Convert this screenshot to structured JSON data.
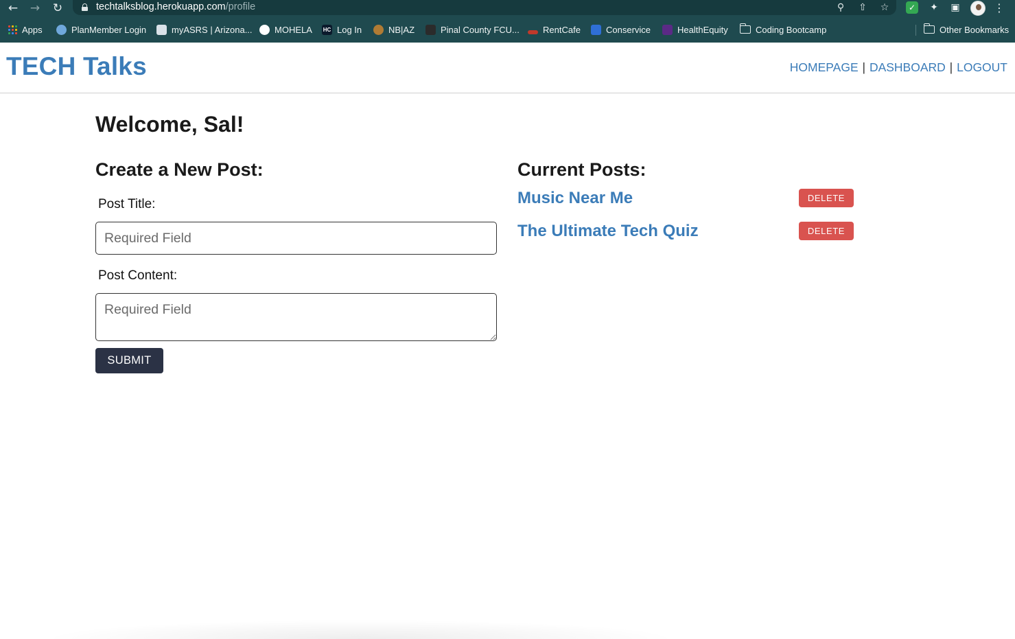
{
  "browser": {
    "url_host": "techtalksblog.herokuapp.com",
    "url_path": "/profile",
    "nav_icons": [
      "arrow-left-icon",
      "arrow-right-icon",
      "reload-icon"
    ],
    "omnibox_icons": [
      "key-icon",
      "share-icon",
      "star-icon"
    ],
    "bookmarks": [
      {
        "label": "Apps",
        "icon": "apps-grid-icon",
        "color": "#e8453c"
      },
      {
        "label": "PlanMember Login",
        "icon": "planmember-favicon",
        "color": "#6fa8dc"
      },
      {
        "label": "myASRS | Arizona...",
        "icon": "myasrs-favicon",
        "color": "#d9e1e8"
      },
      {
        "label": "MOHELA",
        "icon": "mohela-favicon",
        "color": "#ffffff"
      },
      {
        "label": "Log In",
        "icon": "hc-favicon",
        "color": "#0b1a2c"
      },
      {
        "label": "NB|AZ",
        "icon": "nbaz-favicon",
        "color": "#b07b34"
      },
      {
        "label": "Pinal County FCU...",
        "icon": "pinal-favicon",
        "color": "#2b2b2b"
      },
      {
        "label": "RentCafe",
        "icon": "rentcafe-favicon",
        "color": "#c0392b"
      },
      {
        "label": "Conservice",
        "icon": "conservice-favicon",
        "color": "#2f6fd6"
      },
      {
        "label": "HealthEquity",
        "icon": "healthequity-favicon",
        "color": "#5b2a86"
      },
      {
        "label": "Coding Bootcamp",
        "icon": "folder-icon",
        "color": "#e4ecec"
      }
    ],
    "other_bookmarks": "Other Bookmarks"
  },
  "site": {
    "title": "TECH Talks",
    "nav": {
      "homepage": "HOMEPAGE",
      "dashboard": "DASHBOARD",
      "logout": "LOGOUT",
      "separator": "|"
    }
  },
  "main": {
    "welcome": "Welcome, Sal!",
    "create": {
      "heading": "Create a New Post:",
      "title_label": "Post Title:",
      "title_placeholder": "Required Field",
      "title_value": "",
      "content_label": "Post Content:",
      "content_placeholder": "Required Field",
      "content_value": "",
      "submit_label": "SUBMIT"
    },
    "posts": {
      "heading": "Current Posts:",
      "items": [
        {
          "title": "Music Near Me",
          "delete_label": "DELETE"
        },
        {
          "title": "The Ultimate Tech Quiz",
          "delete_label": "DELETE"
        }
      ]
    }
  },
  "colors": {
    "brand_blue": "#3b7cb8",
    "submit_bg": "#2b3245",
    "delete_bg": "#d9534f",
    "browser_bg": "#1f4a4f"
  }
}
